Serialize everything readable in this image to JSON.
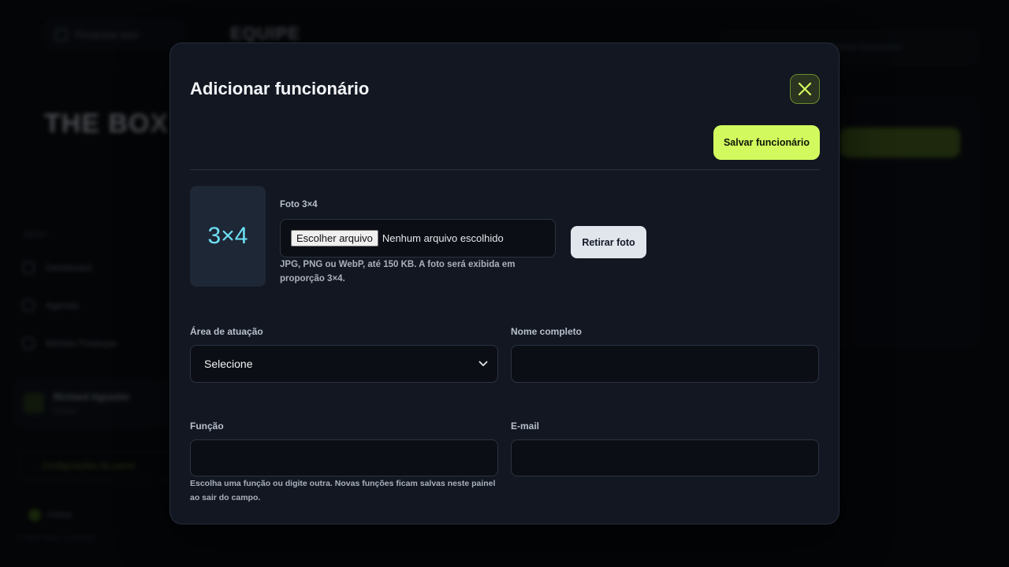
{
  "background": {
    "search_label": "Pesquisar aqui",
    "brand": "EQUIPE",
    "topbar_text": "Buscar funcionário",
    "logo": "THE BOX",
    "menu_title": "MENU",
    "menu_items": [
      "Dashboard",
      "Agenda",
      "Minhas Finanças"
    ],
    "user_name": "Richard Agostini",
    "user_role": "Gestor",
    "cta_label": "Configurações do painel",
    "status_label": "Online",
    "footer": "© 2025 Todos os direitos"
  },
  "modal": {
    "title": "Adicionar funcionário",
    "save_label": "Salvar funcionário",
    "photo": {
      "preview_text": "3×4",
      "label": "Foto 3×4",
      "file_button": "Escolher arquivo",
      "file_status": "Nenhum arquivo escolhido",
      "remove_label": "Retirar foto",
      "hint": "JPG, PNG ou WebP, até 150 KB. A foto será exibida em proporção 3×4."
    },
    "fields": {
      "area_label": "Área de atuação",
      "area_value": "Selecione",
      "name_label": "Nome completo",
      "name_value": "",
      "role_label": "Função",
      "role_value": "",
      "role_hint": "Escolha uma função ou digite outra. Novas funções ficam salvas neste painel ao sair do campo.",
      "email_label": "E-mail",
      "email_value": ""
    }
  },
  "colors": {
    "accent": "#d2fa5e",
    "modal_bg": "#121722",
    "preview_text": "#6ee0f5"
  }
}
